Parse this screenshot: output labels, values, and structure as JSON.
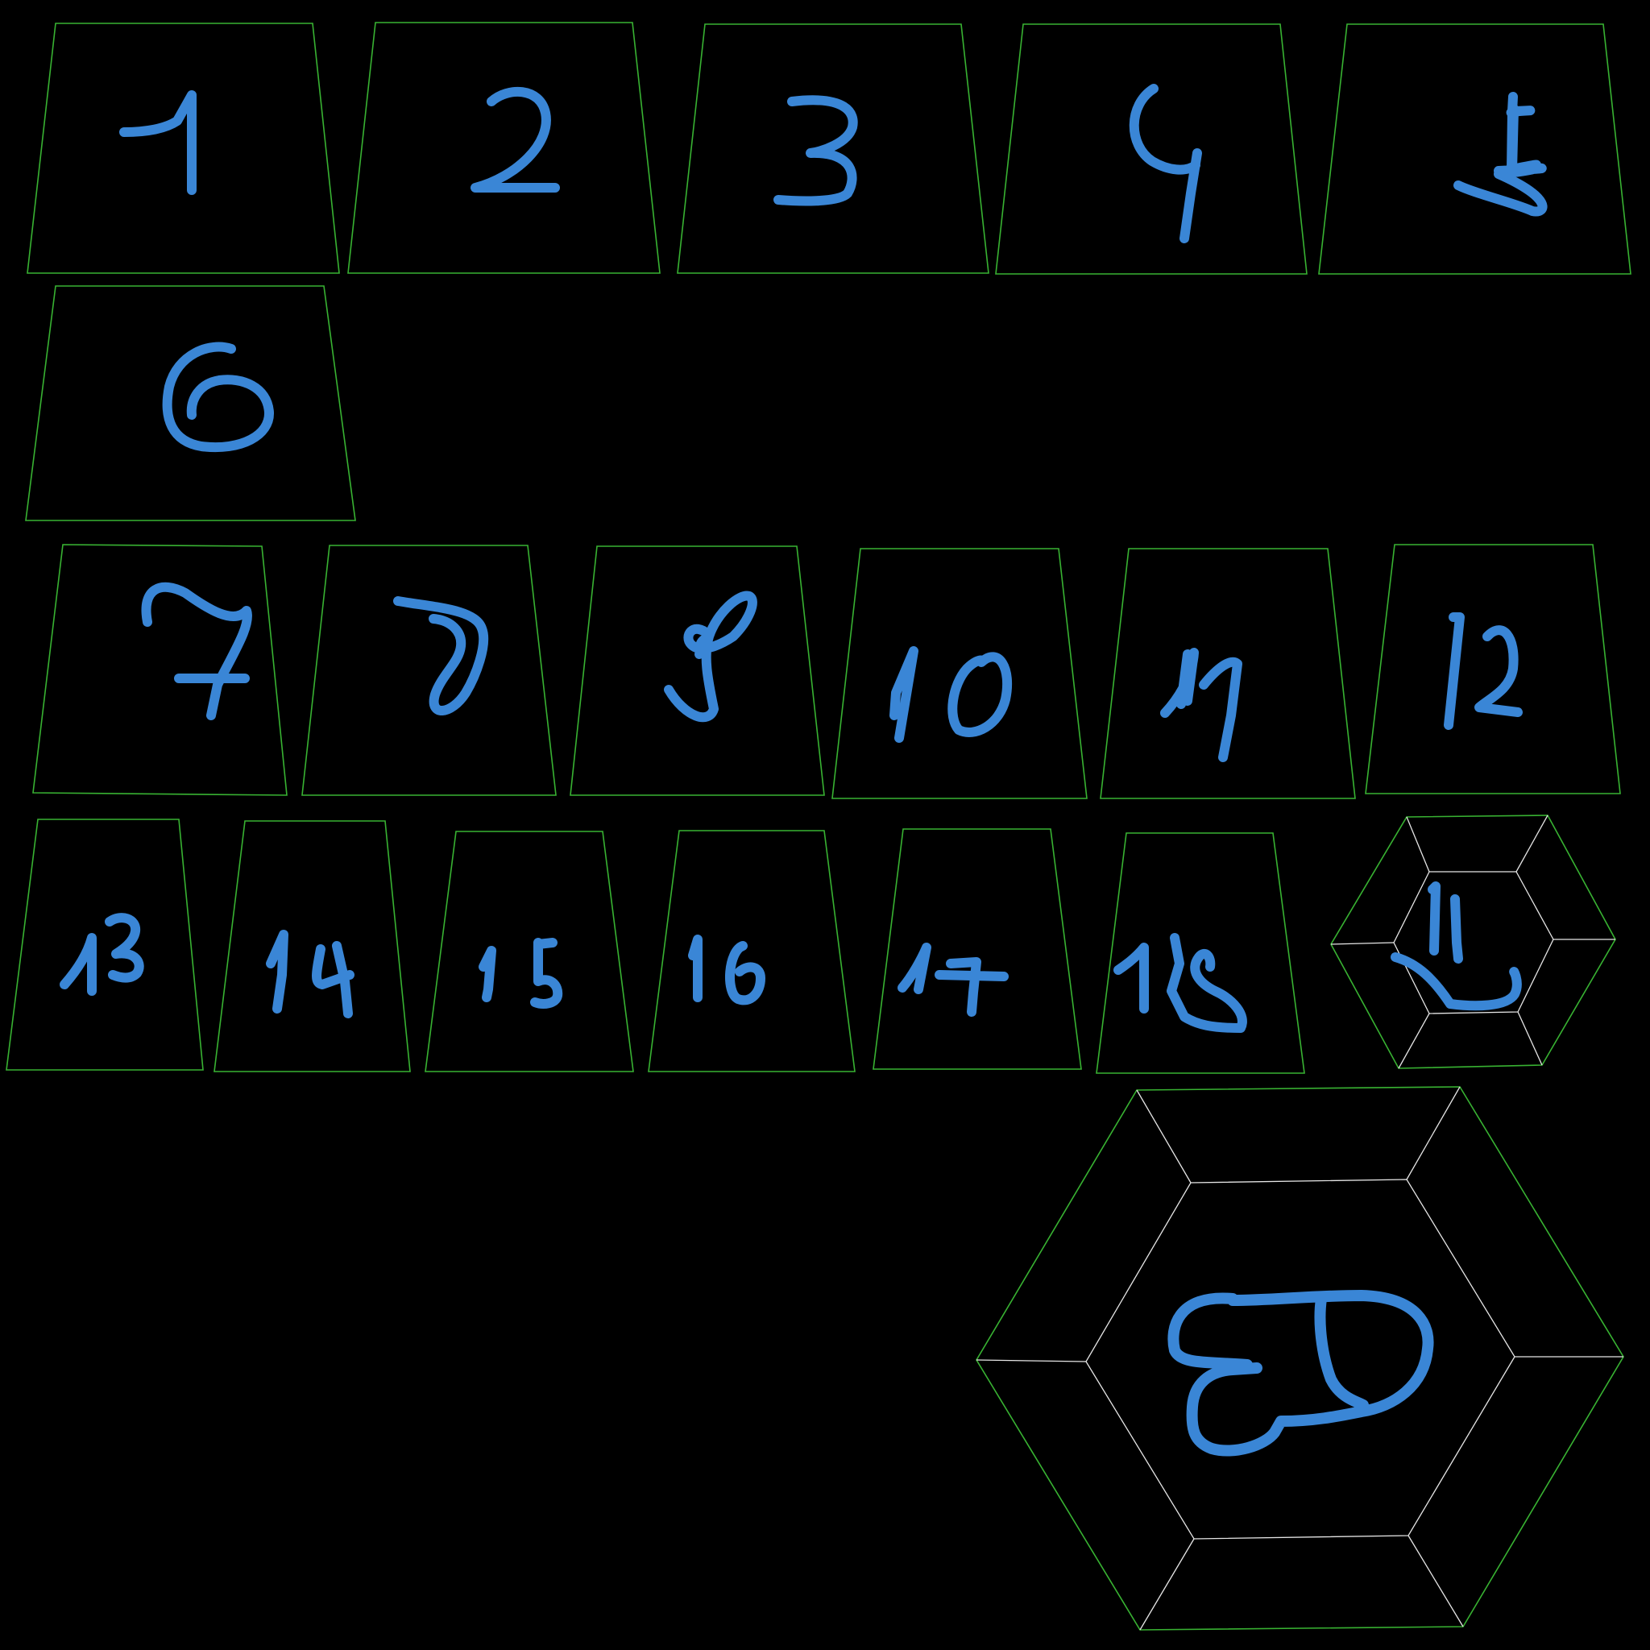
{
  "palette": {
    "background": "#000000",
    "panel_outline": "#38b232",
    "hex_inner_edges": "#e6e6e6",
    "glyph_stroke": "#3a86d6"
  },
  "panels": [
    {
      "label": "1"
    },
    {
      "label": "2"
    },
    {
      "label": "3"
    },
    {
      "label": "4"
    },
    {
      "label": "5"
    },
    {
      "label": "6"
    },
    {
      "label": "7"
    },
    {
      "label": "8"
    },
    {
      "label": "9"
    },
    {
      "label": "10"
    },
    {
      "label": "11"
    },
    {
      "label": "12"
    },
    {
      "label": "13"
    },
    {
      "label": "14"
    },
    {
      "label": "15"
    },
    {
      "label": "16"
    },
    {
      "label": "17"
    },
    {
      "label": "18"
    }
  ],
  "hex_panels": [
    {
      "label": "11",
      "drawing": "smile-face"
    },
    {
      "label": "",
      "drawing": "large-doodle"
    }
  ]
}
